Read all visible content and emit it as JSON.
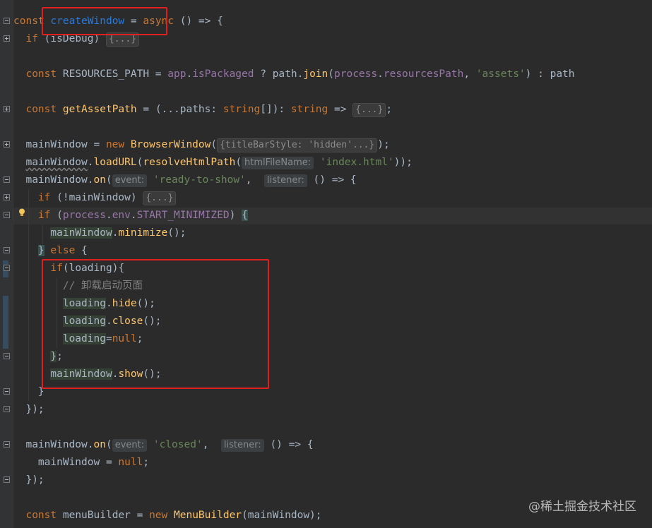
{
  "editor": {
    "lines": [
      {
        "tokens": [
          [
            "kw",
            "const "
          ],
          [
            "blue",
            "createWindow"
          ],
          [
            "id",
            " = "
          ],
          [
            "kw",
            "async"
          ],
          [
            "id",
            " () => {"
          ]
        ]
      },
      {
        "tokens": [
          [
            "id",
            "  "
          ],
          [
            "kw",
            "if"
          ],
          [
            "id",
            " (isDebug) "
          ],
          [
            "collapsed",
            "{...}"
          ]
        ]
      },
      {
        "tokens": []
      },
      {
        "tokens": [
          [
            "id",
            "  "
          ],
          [
            "kw",
            "const "
          ],
          [
            "id",
            "RESOURCES_PATH = "
          ],
          [
            "mem",
            "app"
          ],
          [
            "id",
            "."
          ],
          [
            "mem",
            "isPackaged"
          ],
          [
            "id",
            " ? path."
          ],
          [
            "meth",
            "join"
          ],
          [
            "id",
            "("
          ],
          [
            "mem",
            "process"
          ],
          [
            "id",
            "."
          ],
          [
            "mem",
            "resourcesPath"
          ],
          [
            "id",
            ", "
          ],
          [
            "str",
            "'assets'"
          ],
          [
            "id",
            ") : path"
          ]
        ]
      },
      {
        "tokens": []
      },
      {
        "tokens": [
          [
            "id",
            "  "
          ],
          [
            "kw",
            "const "
          ],
          [
            "fn",
            "getAssetPath"
          ],
          [
            "id",
            " = (...paths: "
          ],
          [
            "kw",
            "string"
          ],
          [
            "id",
            "[]): "
          ],
          [
            "kw",
            "string"
          ],
          [
            "id",
            " => "
          ],
          [
            "collapsed",
            "{...}"
          ],
          [
            "id",
            ";"
          ]
        ]
      },
      {
        "tokens": []
      },
      {
        "tokens": [
          [
            "id",
            "  mainWindow = "
          ],
          [
            "kw",
            "new "
          ],
          [
            "fn",
            "BrowserWindow"
          ],
          [
            "id",
            "("
          ],
          [
            "collapsed",
            "{titleBarStyle: 'hidden'...}"
          ],
          [
            "id",
            ");"
          ]
        ]
      },
      {
        "tokens": [
          [
            "id",
            "  "
          ],
          [
            "wavy",
            "mainWindow"
          ],
          [
            "id",
            "."
          ],
          [
            "meth",
            "loadURL"
          ],
          [
            "id",
            "("
          ],
          [
            "fn",
            "resolveHtmlPath"
          ],
          [
            "id",
            "("
          ],
          [
            "hint",
            "htmlFileName:"
          ],
          [
            "id",
            " "
          ],
          [
            "str",
            "'index.html'"
          ],
          [
            "id",
            "));"
          ]
        ]
      },
      {
        "tokens": [
          [
            "id",
            "  mainWindow."
          ],
          [
            "meth",
            "on"
          ],
          [
            "id",
            "("
          ],
          [
            "hint",
            "event:"
          ],
          [
            "id",
            " "
          ],
          [
            "str",
            "'ready-to-show'"
          ],
          [
            "id",
            ",  "
          ],
          [
            "hint",
            "listener:"
          ],
          [
            "id",
            " () => {"
          ]
        ]
      },
      {
        "tokens": [
          [
            "id",
            "    "
          ],
          [
            "kw",
            "if"
          ],
          [
            "id",
            " (!mainWindow) "
          ],
          [
            "collapsed",
            "{...}"
          ]
        ]
      },
      {
        "tokens": [
          [
            "id",
            "    "
          ],
          [
            "kw",
            "if"
          ],
          [
            "id",
            " ("
          ],
          [
            "mem",
            "process"
          ],
          [
            "id",
            "."
          ],
          [
            "mem",
            "env"
          ],
          [
            "id",
            "."
          ],
          [
            "mem",
            "START_MINIMIZED"
          ],
          [
            "id",
            ") "
          ],
          [
            "bracehl",
            "{"
          ]
        ]
      },
      {
        "tokens": [
          [
            "id",
            "      "
          ],
          [
            "hl",
            "mainWindow"
          ],
          [
            "id",
            "."
          ],
          [
            "meth",
            "minimize"
          ],
          [
            "id",
            "();"
          ]
        ]
      },
      {
        "tokens": [
          [
            "id",
            "    "
          ],
          [
            "bracehl",
            "}"
          ],
          [
            "id",
            " "
          ],
          [
            "kw",
            "else"
          ],
          [
            "id",
            " {"
          ]
        ]
      },
      {
        "tokens": [
          [
            "id",
            "      "
          ],
          [
            "kw",
            "if"
          ],
          [
            "id",
            "(loading){"
          ]
        ]
      },
      {
        "tokens": [
          [
            "id",
            "        "
          ],
          [
            "cmt",
            "// 卸载启动页面"
          ]
        ]
      },
      {
        "tokens": [
          [
            "id",
            "        "
          ],
          [
            "hl",
            "loading"
          ],
          [
            "id",
            "."
          ],
          [
            "meth",
            "hide"
          ],
          [
            "id",
            "();"
          ]
        ]
      },
      {
        "tokens": [
          [
            "id",
            "        "
          ],
          [
            "hl",
            "loading"
          ],
          [
            "id",
            "."
          ],
          [
            "meth",
            "close"
          ],
          [
            "id",
            "();"
          ]
        ]
      },
      {
        "tokens": [
          [
            "id",
            "        "
          ],
          [
            "hl",
            "loading"
          ],
          [
            "id",
            "="
          ],
          [
            "kw",
            "null"
          ],
          [
            "id",
            ";"
          ]
        ]
      },
      {
        "tokens": [
          [
            "id",
            "      "
          ],
          [
            "hl",
            "}"
          ],
          [
            "id",
            ";"
          ]
        ]
      },
      {
        "tokens": [
          [
            "id",
            "      "
          ],
          [
            "hl",
            "mainWindow"
          ],
          [
            "id",
            "."
          ],
          [
            "meth",
            "show"
          ],
          [
            "id",
            "();"
          ]
        ]
      },
      {
        "tokens": [
          [
            "id",
            "    }"
          ]
        ]
      },
      {
        "tokens": [
          [
            "id",
            "  });"
          ]
        ]
      },
      {
        "tokens": []
      },
      {
        "tokens": [
          [
            "id",
            "  mainWindow."
          ],
          [
            "meth",
            "on"
          ],
          [
            "id",
            "("
          ],
          [
            "hint",
            "event:"
          ],
          [
            "id",
            " "
          ],
          [
            "str",
            "'closed'"
          ],
          [
            "id",
            ",  "
          ],
          [
            "hint",
            "listener:"
          ],
          [
            "id",
            " () => {"
          ]
        ]
      },
      {
        "tokens": [
          [
            "id",
            "    mainWindow = "
          ],
          [
            "kw",
            "null"
          ],
          [
            "id",
            ";"
          ]
        ]
      },
      {
        "tokens": [
          [
            "id",
            "  });"
          ]
        ]
      },
      {
        "tokens": []
      },
      {
        "tokens": [
          [
            "id",
            "  "
          ],
          [
            "kw",
            "const "
          ],
          [
            "id",
            "menuBuilder = "
          ],
          [
            "kw",
            "new "
          ],
          [
            "fn",
            "MenuBuilder"
          ],
          [
            "id",
            "(mainWindow);"
          ]
        ]
      }
    ]
  },
  "watermark": "@稀土掘金技术社区",
  "colors": {
    "background": "#2b2b2b",
    "keyword": "#cc7832",
    "function": "#ffc66d",
    "member": "#9876aa",
    "string": "#6a8759",
    "comment": "#808080",
    "annotation_box": "#e0201f"
  },
  "icons": [
    "fold-icon",
    "lightbulb-icon"
  ]
}
